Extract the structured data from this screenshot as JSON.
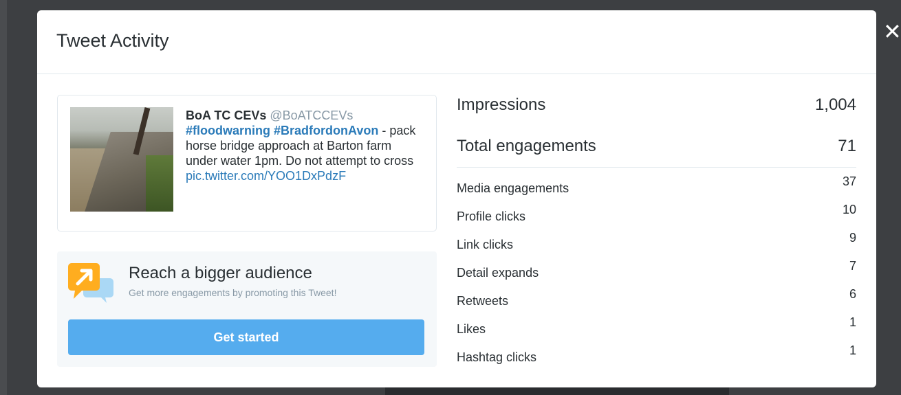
{
  "modal": {
    "title": "Tweet Activity",
    "close_label": "✕"
  },
  "tweet": {
    "author": "BoA TC CEVs",
    "handle": "@BoATCCEVs",
    "hashtag1": "#floodwarning",
    "hashtag2": "#BradfordonAvon",
    "text": " - pack horse bridge approach at Barton farm under water 1pm. Do not attempt to cross",
    "link": "pic.twitter.com/YOO1DxPdzF"
  },
  "promo": {
    "title": "Reach a bigger audience",
    "subtitle": "Get more engagements by promoting this Tweet!",
    "button_label": "Get started"
  },
  "stats": {
    "impressions_label": "Impressions",
    "impressions_value": "1,004",
    "engagements_label": "Total engagements",
    "engagements_value": "71",
    "metrics": [
      {
        "label": "Media engagements",
        "value": "37"
      },
      {
        "label": "Profile clicks",
        "value": "10"
      },
      {
        "label": "Link clicks",
        "value": "9"
      },
      {
        "label": "Detail expands",
        "value": "7"
      },
      {
        "label": "Retweets",
        "value": "6"
      },
      {
        "label": "Likes",
        "value": "1"
      },
      {
        "label": "Hashtag clicks",
        "value": "1"
      }
    ]
  },
  "colors": {
    "accent": "#55acee",
    "link": "#2b7bb9",
    "promo_icon": "#ffad1f",
    "promo_icon_secondary": "#aad8f5"
  }
}
